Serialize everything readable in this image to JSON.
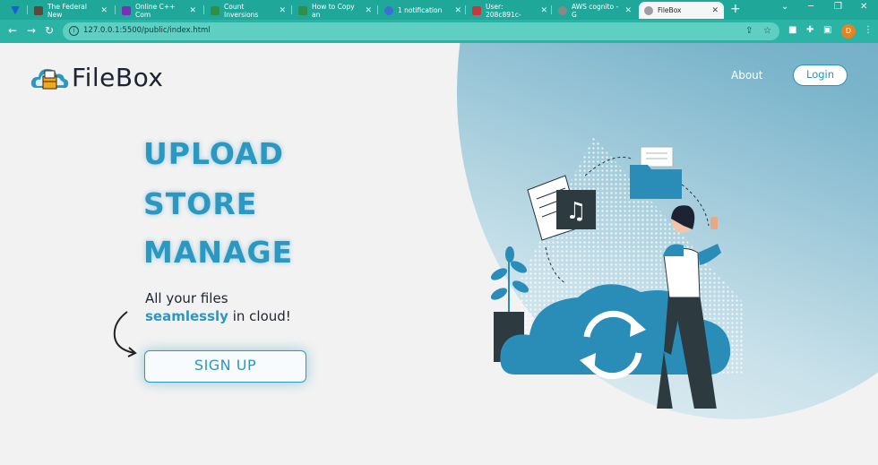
{
  "browser": {
    "tabs": [
      {
        "label": "",
        "favicon_color": "#1e5dd6"
      },
      {
        "label": "The Federal New",
        "favicon_color": "#5a4a3a"
      },
      {
        "label": "Online C++ Com",
        "favicon_color": "#7b2fb8"
      },
      {
        "label": "Count Inversions",
        "favicon_color": "#2f8f46"
      },
      {
        "label": "How to Copy an",
        "favicon_color": "#2f8f46"
      },
      {
        "label": "1 notification",
        "favicon_color": "#3a6fd8"
      },
      {
        "label": "User: 208c891c-",
        "favicon_color": "#c8383a"
      },
      {
        "label": "AWS cognito - G",
        "favicon_color": "#888888"
      },
      {
        "label": "FileBox",
        "favicon_color": "#9aa0a6"
      }
    ],
    "url": "127.0.0.1:5500/public/index.html",
    "profile_initial": "D"
  },
  "site": {
    "brand": "FileBox",
    "nav": {
      "about": "About",
      "login": "Login"
    },
    "headlines": [
      "UPLOAD",
      "STORE",
      "MANAGE"
    ],
    "tagline_line1": "All your files",
    "tagline_accent": "seamlessly",
    "tagline_rest": " in cloud!",
    "cta": "SIGN UP"
  },
  "colors": {
    "accent": "#2a98c0",
    "chrome": "#1fa79a",
    "text_dark": "#1d2333"
  }
}
